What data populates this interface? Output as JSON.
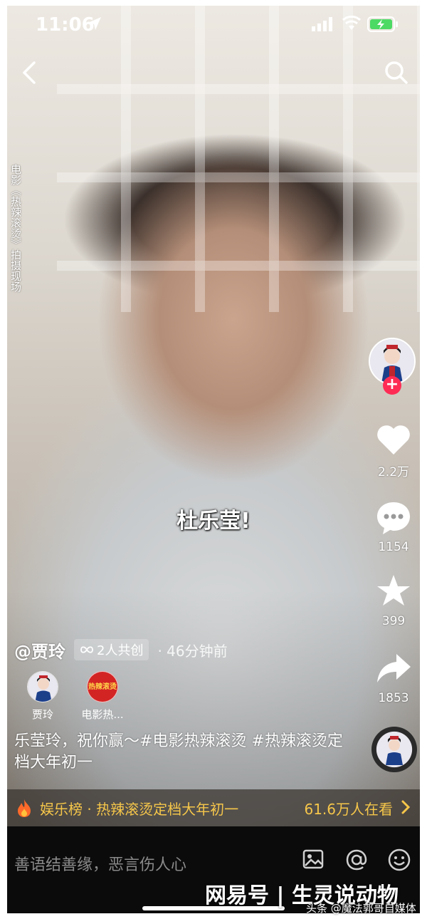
{
  "status_bar": {
    "time": "11:06"
  },
  "video": {
    "side_caption": "电影《热辣滚烫》拍摄现场",
    "subtitle": "杜乐莹!"
  },
  "actions": {
    "likes": "2.2万",
    "comments": "1154",
    "favorites": "399",
    "shares": "1853"
  },
  "author": {
    "handle": "@贾玲",
    "co_create": "2人共创",
    "time_ago": "· 46分钟前"
  },
  "cocreators": [
    {
      "name": "贾玲"
    },
    {
      "name": "电影热...",
      "avatar_text": "热辣滚烫"
    }
  ],
  "caption": "乐莹玲，祝你赢～#电影热辣滚烫 #热辣滚烫定档大年初一",
  "hot_list": {
    "title": "娱乐榜 · 热辣滚烫定档大年初一",
    "viewers": "61.6万人在看",
    "color": "#f5c64a"
  },
  "comment_bar": {
    "placeholder": "善语结善缘，恶言伤人心"
  },
  "watermark": {
    "main": "网易号 | 生灵说动物",
    "sub": "头条 @魔法郭哥自媒体"
  },
  "colors": {
    "follow": "#fe2c55",
    "background": "#000000"
  }
}
